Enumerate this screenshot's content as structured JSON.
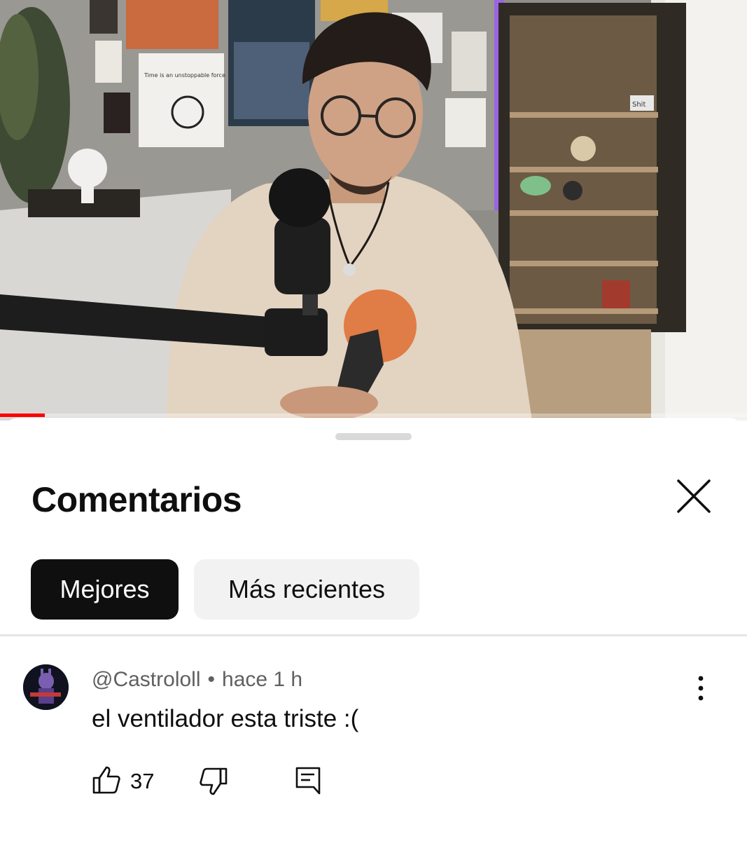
{
  "video": {
    "progress_fraction": 0.06,
    "poster_text": "Time is an unstoppable force",
    "box_label": "Shit"
  },
  "comments": {
    "title": "Comentarios",
    "filters": [
      {
        "label": "Mejores",
        "selected": true
      },
      {
        "label": "Más recientes",
        "selected": false
      }
    ],
    "items": [
      {
        "author": "@Castrololl",
        "separator": "•",
        "time": "hace 1 h",
        "text": "el ventilador esta triste :(",
        "likes": "37"
      }
    ]
  },
  "icons": {
    "close": "close-icon",
    "more": "more-vert-icon",
    "like": "thumb-up-icon",
    "dislike": "thumb-down-icon",
    "reply": "reply-comment-icon"
  },
  "colors": {
    "active_chip": "#0f0f0f",
    "inactive_chip": "#f2f2f2",
    "secondary_text": "#606060",
    "progress": "#ff0000"
  }
}
